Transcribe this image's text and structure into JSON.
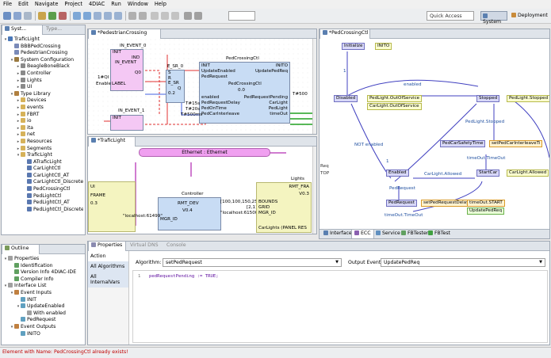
{
  "menu": [
    "File",
    "Edit",
    "Navigate",
    "Project",
    "4DIAC",
    "Run",
    "Window",
    "Help"
  ],
  "toolbar": {
    "quick_access": "Quick Access",
    "system_label": "System",
    "deployment_label": "Deployment"
  },
  "system_explorer": {
    "tabs": [
      "Syst...",
      "Type..."
    ],
    "items": [
      {
        "label": "TraficLight",
        "depth": 0,
        "arrow": "▾"
      },
      {
        "label": "BBBPedCrossing",
        "depth": 1,
        "arrow": ""
      },
      {
        "label": "PedestrianCrossing",
        "depth": 1,
        "arrow": ""
      },
      {
        "label": "System Configuration",
        "depth": 1,
        "arrow": "▾"
      },
      {
        "label": "BeagleBoneBlack",
        "depth": 2,
        "arrow": "▸"
      },
      {
        "label": "Controller",
        "depth": 2,
        "arrow": "▸"
      },
      {
        "label": "Lights",
        "depth": 2,
        "arrow": "▸"
      },
      {
        "label": "UI",
        "depth": 2,
        "arrow": "▸"
      },
      {
        "label": "Type Library",
        "depth": 1,
        "arrow": "▾"
      },
      {
        "label": "Devices",
        "depth": 2,
        "arrow": "▸"
      },
      {
        "label": "events",
        "depth": 2,
        "arrow": "▸"
      },
      {
        "label": "FBRT",
        "depth": 2,
        "arrow": "▸"
      },
      {
        "label": "io",
        "depth": 2,
        "arrow": "▸"
      },
      {
        "label": "ita",
        "depth": 2,
        "arrow": "▸"
      },
      {
        "label": "net",
        "depth": 2,
        "arrow": "▸"
      },
      {
        "label": "Resources",
        "depth": 2,
        "arrow": "▸"
      },
      {
        "label": "Segments",
        "depth": 2,
        "arrow": "▸"
      },
      {
        "label": "TraficLight",
        "depth": 2,
        "arrow": "▾"
      },
      {
        "label": "ATraficLight",
        "depth": 3,
        "arrow": ""
      },
      {
        "label": "CarLightCtl",
        "depth": 3,
        "arrow": ""
      },
      {
        "label": "CarLightCtl_AT",
        "depth": 3,
        "arrow": ""
      },
      {
        "label": "CarLightCtl_Discrete",
        "depth": 3,
        "arrow": ""
      },
      {
        "label": "PedCrossingCtl",
        "depth": 3,
        "arrow": ""
      },
      {
        "label": "PedLightCtl",
        "depth": 3,
        "arrow": ""
      },
      {
        "label": "PedLightCtl_AT",
        "depth": 3,
        "arrow": ""
      },
      {
        "label": "PedLightCtl_Discrete",
        "depth": 3,
        "arrow": ""
      }
    ]
  },
  "outline": {
    "tab": "Outline",
    "items": [
      {
        "label": "Properties",
        "depth": 0,
        "arrow": "▾"
      },
      {
        "label": "Identification",
        "depth": 1,
        "arrow": ""
      },
      {
        "label": "Version Info 4DIAC-IDE",
        "depth": 1,
        "arrow": ""
      },
      {
        "label": "Compiler Info",
        "depth": 1,
        "arrow": ""
      },
      {
        "label": "Interface List",
        "depth": 0,
        "arrow": "▾"
      },
      {
        "label": "Event Inputs",
        "depth": 1,
        "arrow": "▾"
      },
      {
        "label": "INIT",
        "depth": 2,
        "arrow": ""
      },
      {
        "label": "UpdateEnabled",
        "depth": 2,
        "arrow": "▾"
      },
      {
        "label": "With enabled",
        "depth": 3,
        "arrow": ""
      },
      {
        "label": "PedRequest",
        "depth": 2,
        "arrow": ""
      },
      {
        "label": "Event Outputs",
        "depth": 1,
        "arrow": "▾"
      },
      {
        "label": "INITO",
        "depth": 2,
        "arrow": ""
      }
    ]
  },
  "editor1": {
    "tab": "*PedestrianCrossing",
    "fb_in_event_0": {
      "name": "IN_EVENT_0",
      "pins_left": [
        "INIT",
        "IND",
        "",
        "Enable"
      ],
      "pins_right": [
        "",
        "",
        "Q0"
      ],
      "type": "IN_EVENT"
    },
    "fb_in_event_1": {
      "name": "IN_EVENT_1",
      "pins": [
        "INIT"
      ]
    },
    "fb_esr": {
      "name": "E_SR_0",
      "type": "E_SR",
      "pins": [
        "S",
        "R",
        "Q",
        "0.2"
      ]
    },
    "fb_ctl": {
      "name": "PedCrossingCtl",
      "type": "PedCrossingCtl",
      "left": [
        "INIT",
        "UpdateEnabled",
        "PedRequest",
        "enabled",
        "PedRequestDelay",
        "PedOnTime",
        "PedCarInterleave"
      ],
      "right": [
        "INITO",
        "UpdatePedReq",
        "",
        "PedRequestPending",
        "CarLight",
        "PedLight",
        "timeOut"
      ],
      "version": "0.0"
    },
    "left_labels": [
      "1#QI",
      "LABEL",
      "Enable"
    ],
    "time_labels": [
      "T#15s",
      "T#20s",
      "T#500ms",
      "T#500"
    ],
    "q_label": "1#QI"
  },
  "editor2": {
    "tab": "*TraficLight",
    "segment": "Ethernet : Ethernet",
    "ui": {
      "name": "UI",
      "type": "FRAME",
      "version": "0.3"
    },
    "controller": {
      "name": "Controller",
      "type": "RMT_DEV",
      "version": "V0.4",
      "pin": "MGR_ID",
      "addr": "\"localhost:61499\"",
      "params": "[100,100,150,250]",
      "params2": "[2,1]",
      "addr2": "\"localhost:61500\""
    },
    "lights": {
      "name": "Lights",
      "type": "RMT_FRA",
      "version": "V0.3",
      "pins": [
        "BOUNDS",
        "GRID",
        "MGR_ID"
      ],
      "partial": "CarLights (PANEL RES"
    }
  },
  "ecc_editor": {
    "tab": "*PedCrossingCtl",
    "states": [
      "Initialize",
      "Disabled",
      "Stopped",
      "PedCarSafetyTime",
      "StartCar",
      "Enabled",
      "PedRequest"
    ],
    "actions": [
      "INITO",
      "PedLight.OutOfService",
      "CarLight.OutOfService",
      "PedLight.Stopped",
      "setPedCarInterleaveTi",
      "CarLight.Allowed",
      "setPedRequestDelay",
      "timeOut.START",
      "UpdatePedReq"
    ],
    "transitions": [
      "1",
      "enabled",
      "NOT enabled",
      "PedLight.Stopped",
      "timeOut.TimeOut",
      "CarLight.Allowed",
      "1",
      "PedRequest",
      "timeOut.TimeOut"
    ],
    "left_side": [
      "Req",
      "TOP"
    ],
    "bottom_tabs": [
      "Interface",
      "ECC",
      "Service",
      "FBTester",
      "FBTest"
    ]
  },
  "properties": {
    "tabs": [
      "Properties",
      "Virtual DNS",
      "Console"
    ],
    "sidebar": [
      "Action",
      "All Algorithms",
      "All InternalVars"
    ],
    "algorithm_label": "Algorithm:",
    "algorithm_value": "setPedRequest",
    "output_event_label": "Output Event:",
    "output_event_value": "UpdatePedReq",
    "code_line_no": "1",
    "code": "pedRequestPending := TRUE;"
  },
  "status": {
    "message": "Element with Name: PedCrossingCtl already exists!"
  },
  "colors": {
    "state_fill": "#d8d8f8",
    "action_fill": "#fcffd0",
    "fb_fill": "#c8dcf4",
    "pink_fb": "#f4c8f4",
    "error": "#c00000"
  }
}
